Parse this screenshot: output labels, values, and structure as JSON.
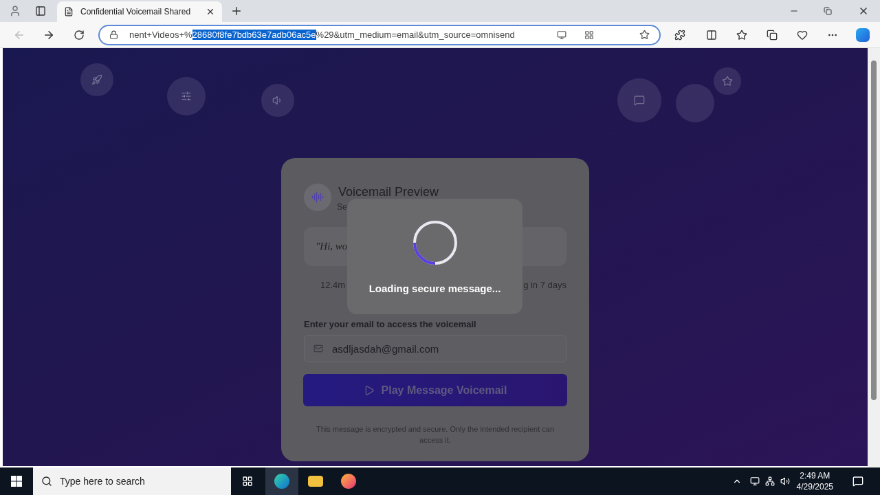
{
  "browser": {
    "tab": {
      "title": "Confidential Voicemail Shared",
      "selected": true
    },
    "address": {
      "before": "nent+Videos+%",
      "selected": "28680f8fe7bdb63e7adb06ac5e",
      "after": "%29&utm_medium=email&utm_source=omnisend"
    }
  },
  "page": {
    "title": "Voicemail Preview",
    "subtitle": "Se",
    "quote": "\"Hi, wo",
    "duration": "12.4m",
    "expiry": "g in 7 days",
    "email_label": "Enter your email to access the voicemail",
    "email_value": "asdljasdah@gmail.com",
    "play_button": "Play Message Voicemail",
    "note": "This message is encrypted and secure. Only the intended recipient can access it.",
    "loading": {
      "text": "Loading secure message..."
    }
  },
  "taskbar": {
    "search_placeholder": "Type here to search",
    "time": "2:49 AM",
    "date": "4/29/2025"
  }
}
